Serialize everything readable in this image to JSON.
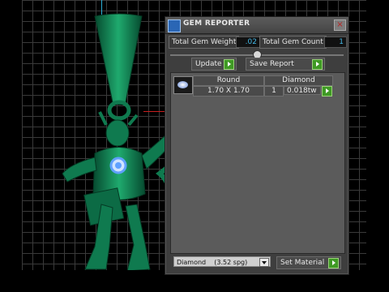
{
  "panel": {
    "title": "GEM REPORTER",
    "close_label": "×",
    "total_weight_label": "Total Gem Weight",
    "total_weight_value": ".02",
    "total_count_label": "Total Gem Count",
    "total_count_value": "1",
    "update_label": "Update",
    "save_report_label": "Save Report",
    "table": {
      "headers": [
        "Round",
        "Diamond"
      ],
      "rows": [
        {
          "size": "1.70 X 1.70",
          "count": "1",
          "weight": "0.018tw"
        }
      ]
    },
    "material_select": "Diamond    (3.52 spg)",
    "set_material_label": "Set Material"
  },
  "colors": {
    "figure": "#0f7a4f",
    "gem": "#5fa0ff",
    "accent_green": "#3f9a24",
    "value_text": "#44b8e6"
  }
}
